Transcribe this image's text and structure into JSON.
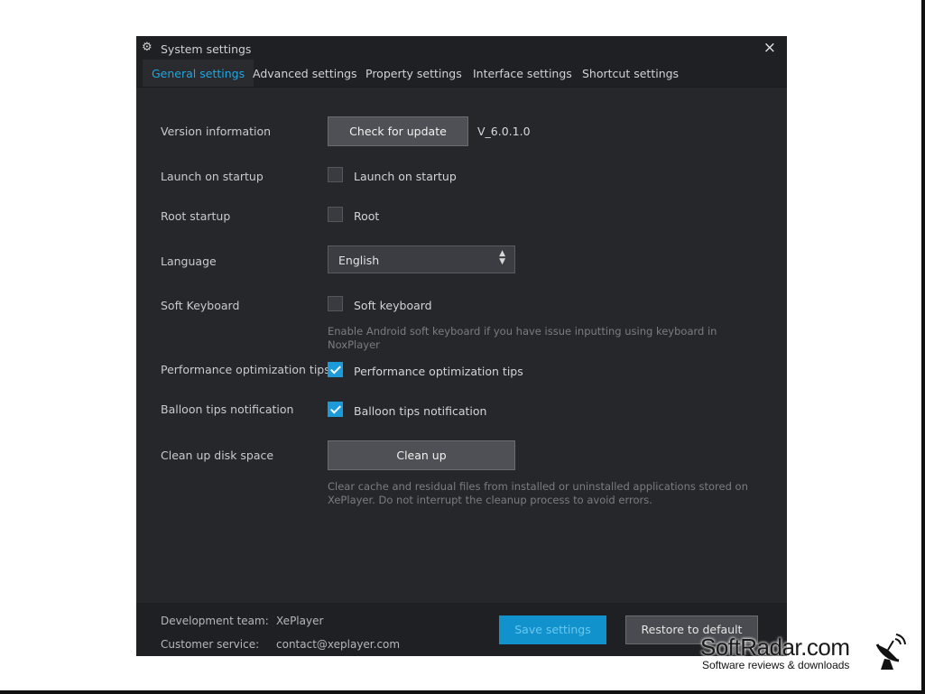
{
  "window": {
    "title": "System settings",
    "close": "×"
  },
  "tabs": [
    {
      "label": "General settings",
      "active": true
    },
    {
      "label": "Advanced settings",
      "active": false
    },
    {
      "label": "Property settings",
      "active": false
    },
    {
      "label": "Interface settings",
      "active": false
    },
    {
      "label": "Shortcut settings",
      "active": false
    }
  ],
  "general": {
    "version": {
      "label": "Version information",
      "button": "Check for update",
      "value": "V_6.0.1.0"
    },
    "launch_startup": {
      "label": "Launch on startup",
      "checkbox_label": "Launch on startup",
      "checked": false
    },
    "root_startup": {
      "label": "Root startup",
      "checkbox_label": "Root",
      "checked": false
    },
    "language": {
      "label": "Language",
      "selected": "English"
    },
    "soft_keyboard": {
      "label": "Soft Keyboard",
      "checkbox_label": "Soft keyboard",
      "checked": false,
      "hint_line1": "Enable Android soft keyboard if you have issue inputting using keyboard in",
      "hint_line2": "NoxPlayer"
    },
    "perf_tips": {
      "label": "Performance optimization tips",
      "checkbox_label": "Performance optimization tips",
      "checked": true
    },
    "balloon_tips": {
      "label": "Balloon tips notification",
      "checkbox_label": "Balloon tips notification",
      "checked": true
    },
    "cleanup": {
      "label": "Clean up disk space",
      "button": "Clean up",
      "hint_line1": "Clear cache and residual files from installed or uninstalled applications stored on",
      "hint_line2": "XePlayer. Do not interrupt the cleanup process to avoid errors."
    }
  },
  "footer": {
    "dev_team_label": "Development team:",
    "dev_team_value": "XePlayer",
    "customer_service_label": "Customer service:",
    "customer_service_value": "contact@xeplayer.com",
    "save_button": "Save settings",
    "restore_button": "Restore to default"
  },
  "watermark": {
    "brand": "SoftRadar.com",
    "tagline": "Software reviews & downloads"
  },
  "colors": {
    "accent": "#1ea7e2",
    "window_bg": "#26272b",
    "bar_bg": "#1f2023",
    "checked": "#1b9bd9"
  },
  "icons": {
    "title": "gear-icon",
    "close": "close-icon",
    "select": "chevron-up-down-icon",
    "watermark": "satellite-dish-icon"
  }
}
